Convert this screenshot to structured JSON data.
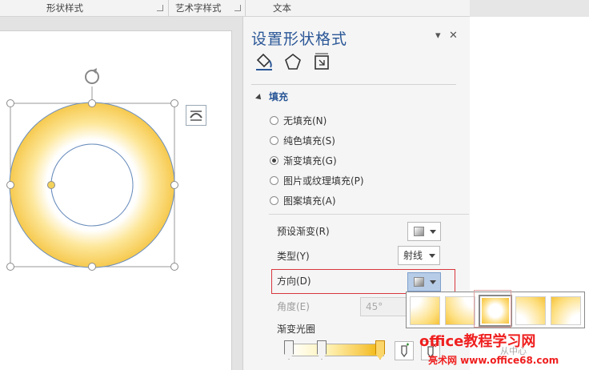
{
  "ribbon": {
    "group1": "形状样式",
    "group2": "艺术字样式",
    "group3": "文本"
  },
  "pane": {
    "title": "设置形状格式",
    "options_icon": "▾",
    "close_icon": "✕",
    "section": "填充",
    "fill_options": [
      {
        "label": "无填充(N)",
        "selected": false
      },
      {
        "label": "纯色填充(S)",
        "selected": false
      },
      {
        "label": "渐变填充(G)",
        "selected": true
      },
      {
        "label": "图片或纹理填充(P)",
        "selected": false
      },
      {
        "label": "图案填充(A)",
        "selected": false
      }
    ],
    "preset_label": "预设渐变(R)",
    "type_label": "类型(Y)",
    "type_value": "射线",
    "direction_label": "方向(D)",
    "angle_label": "角度(E)",
    "angle_value": "45°",
    "stops_label": "渐变光圈",
    "behind_text": "从中心"
  },
  "watermark": {
    "line1": "office教程学习网",
    "line2": "亮术网 www.office68.com"
  },
  "colors": {
    "accent": "#2b5797",
    "highlight": "#d9363e",
    "shape_outline": "#6b8ebd",
    "gradient_outer": "#f9cf56",
    "gradient_inner": "#ffffff"
  }
}
